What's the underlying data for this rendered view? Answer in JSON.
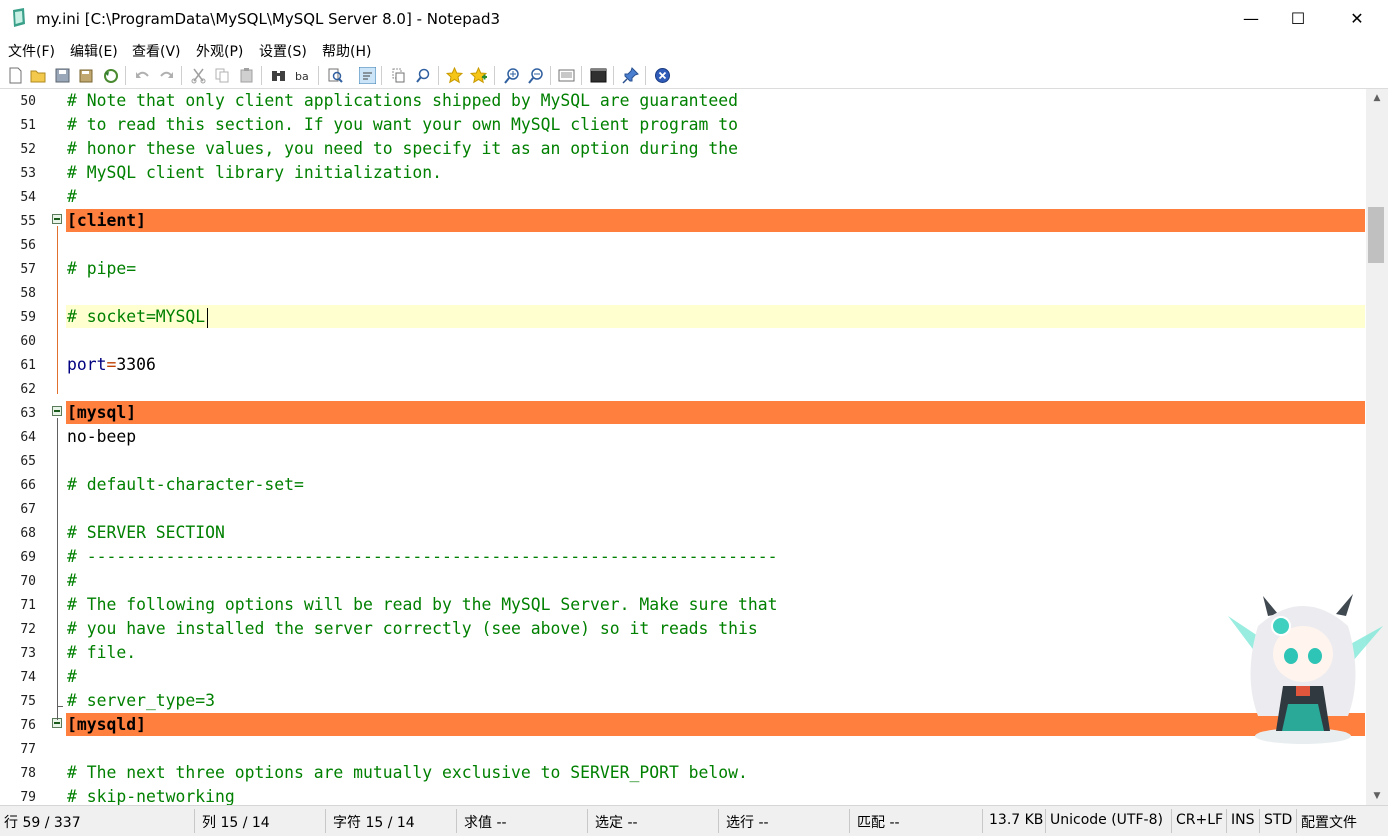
{
  "window": {
    "title": "my.ini [C:\\ProgramData\\MySQL\\MySQL Server 8.0] - Notepad3",
    "minimize": "—",
    "maximize": "☐",
    "close": "✕"
  },
  "menu": [
    "文件(F)",
    "编辑(E)",
    "查看(V)",
    "外观(P)",
    "设置(S)",
    "帮助(H)"
  ],
  "toolbar_icons": [
    "new-file-icon",
    "open-folder-icon",
    "save-icon",
    "save-as-icon",
    "revert-icon",
    "undo-icon",
    "redo-icon",
    "cut-icon",
    "copy-icon",
    "paste-icon",
    "find-icon",
    "replace-icon",
    "find-in-files-icon",
    "word-wrap-icon",
    "select-all-icon",
    "goto-icon",
    "favorites-icon",
    "add-favorite-icon",
    "zoom-in-icon",
    "zoom-out-icon",
    "scheme-icon",
    "command-prompt-icon",
    "pin-icon",
    "exit-icon"
  ],
  "editor": {
    "lines": [
      {
        "num": "50",
        "kind": "comment",
        "text": "# Note that only client applications shipped by MySQL are guaranteed"
      },
      {
        "num": "51",
        "kind": "comment",
        "text": "# to read this section. If you want your own MySQL client program to"
      },
      {
        "num": "52",
        "kind": "comment",
        "text": "# honor these values, you need to specify it as an option during the"
      },
      {
        "num": "53",
        "kind": "comment",
        "text": "# MySQL client library initialization."
      },
      {
        "num": "54",
        "kind": "comment",
        "text": "#"
      },
      {
        "num": "55",
        "kind": "section",
        "text": "[client]"
      },
      {
        "num": "56",
        "kind": "blank",
        "text": ""
      },
      {
        "num": "57",
        "kind": "comment",
        "text": "# pipe="
      },
      {
        "num": "58",
        "kind": "blank",
        "text": ""
      },
      {
        "num": "59",
        "kind": "current",
        "text": "# socket=MYSQL"
      },
      {
        "num": "60",
        "kind": "blank",
        "text": ""
      },
      {
        "num": "61",
        "kind": "keyval",
        "key": "port",
        "eq": "=",
        "val": "3306"
      },
      {
        "num": "62",
        "kind": "blank",
        "text": ""
      },
      {
        "num": "63",
        "kind": "section",
        "text": "[mysql]"
      },
      {
        "num": "64",
        "kind": "plain",
        "text": "no-beep"
      },
      {
        "num": "65",
        "kind": "blank",
        "text": ""
      },
      {
        "num": "66",
        "kind": "comment",
        "text": "# default-character-set="
      },
      {
        "num": "67",
        "kind": "blank",
        "text": ""
      },
      {
        "num": "68",
        "kind": "comment",
        "text": "# SERVER SECTION"
      },
      {
        "num": "69",
        "kind": "comment",
        "text": "# ----------------------------------------------------------------------"
      },
      {
        "num": "70",
        "kind": "comment",
        "text": "#"
      },
      {
        "num": "71",
        "kind": "comment",
        "text": "# The following options will be read by the MySQL Server. Make sure that"
      },
      {
        "num": "72",
        "kind": "comment",
        "text": "# you have installed the server correctly (see above) so it reads this"
      },
      {
        "num": "73",
        "kind": "comment",
        "text": "# file."
      },
      {
        "num": "74",
        "kind": "comment",
        "text": "#"
      },
      {
        "num": "75",
        "kind": "comment",
        "text": "# server_type=3"
      },
      {
        "num": "76",
        "kind": "section",
        "text": "[mysqld]"
      },
      {
        "num": "77",
        "kind": "blank",
        "text": ""
      },
      {
        "num": "78",
        "kind": "comment",
        "text": "# The next three options are mutually exclusive to SERVER_PORT below."
      },
      {
        "num": "79",
        "kind": "comment",
        "text": "# skip-networking"
      }
    ]
  },
  "statusbar": {
    "line": "行 59 / 337",
    "col": "列 15 / 14",
    "char": "字符 15 / 14",
    "value": "求值 --",
    "selection": "选定 --",
    "selected_lines": "选行 --",
    "match": "匹配 --",
    "size": "13.7 KB",
    "encoding": "Unicode (UTF-8)",
    "eol": "CR+LF",
    "ins": "INS",
    "std": "STD",
    "config": "配置文件"
  },
  "colors": {
    "section_highlight": "#ff7f3f",
    "current_line": "#ffffd0",
    "comment": "#008000"
  }
}
